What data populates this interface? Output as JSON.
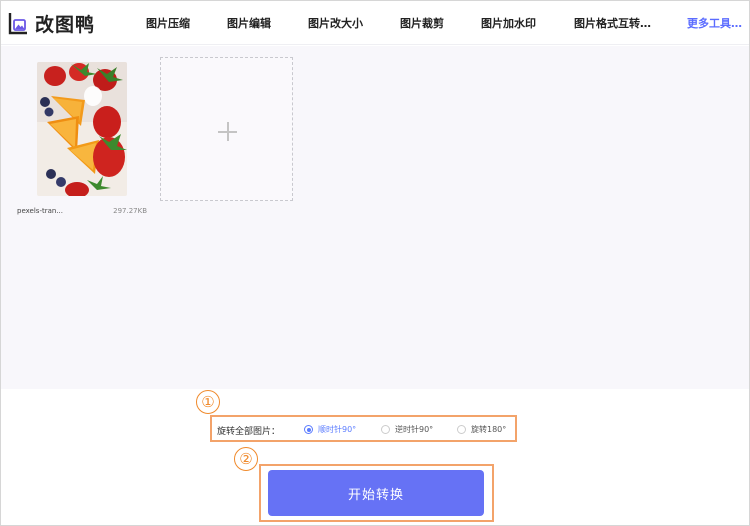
{
  "header": {
    "logo_text": "改图鸭",
    "nav": [
      {
        "label": "图片压缩"
      },
      {
        "label": "图片编辑"
      },
      {
        "label": "图片改大小"
      },
      {
        "label": "图片裁剪"
      },
      {
        "label": "图片加水印"
      },
      {
        "label": "图片格式互转…"
      },
      {
        "label": "更多工具…"
      }
    ]
  },
  "files": [
    {
      "name": "pexels-tran...",
      "size": "297.27KB"
    }
  ],
  "add_box": {
    "icon": "plus-icon"
  },
  "markers": {
    "one": "①",
    "two": "②"
  },
  "rotate": {
    "label": "旋转全部图片：",
    "options": [
      {
        "label": "顺时针90°",
        "checked": true
      },
      {
        "label": "逆时针90°",
        "checked": false
      },
      {
        "label": "旋转180°",
        "checked": false
      }
    ]
  },
  "start_button": {
    "label": "开始转换"
  },
  "colors": {
    "accent": "#6672f5",
    "highlight": "#f08a2c",
    "nav_more": "#5b6cff"
  }
}
